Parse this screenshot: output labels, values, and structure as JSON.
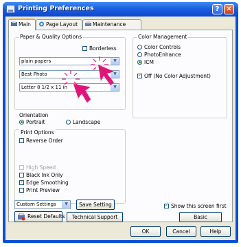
{
  "window": {
    "title": "Printing Preferences",
    "help_glyph": "?",
    "close_glyph": "✕"
  },
  "tabs": [
    {
      "label": "Main"
    },
    {
      "label": "Page Layout"
    },
    {
      "label": "Maintenance"
    }
  ],
  "paper_quality": {
    "title": "Paper & Quality Options",
    "borderless_label": "Borderless",
    "borderless_checked": false,
    "paper_type": "plain papers",
    "quality": "Best Photo",
    "paper_size": "Letter 8 1/2 x 11 in"
  },
  "orientation": {
    "title": "Orientation",
    "portrait_label": "Portrait",
    "landscape_label": "Landscape",
    "selected": "Portrait"
  },
  "print_options": {
    "title": "Print Options",
    "reverse_order_label": "Reverse Order",
    "reverse_order_checked": false,
    "high_speed_label": "High Speed",
    "high_speed_enabled": false,
    "black_ink_only_label": "Black Ink Only",
    "black_ink_only_checked": false,
    "edge_smoothing_label": "Edge Smoothing",
    "edge_smoothing_checked": true,
    "print_preview_label": "Print Preview",
    "print_preview_checked": false
  },
  "color_management": {
    "title": "Color Management",
    "options": [
      "Color Controls",
      "PhotoEnhance",
      "ICM"
    ],
    "selected": "ICM",
    "icm_off_label": "Off (No Color Adjustment)",
    "icm_off_checked": true
  },
  "custom_settings": {
    "value": "Custom Settings",
    "save_label": "Save Setting"
  },
  "show_first": {
    "label": "Show this screen first",
    "checked": true
  },
  "buttons": {
    "reset_defaults": "Reset Defaults",
    "technical_support": "Technical Support",
    "basic": "Basic",
    "ok": "OK",
    "cancel": "Cancel",
    "help": "Help"
  },
  "colors": {
    "title_bar": "#0b47cf",
    "annotation": "#e0157a",
    "dialog_bg": "#ece9d8"
  }
}
